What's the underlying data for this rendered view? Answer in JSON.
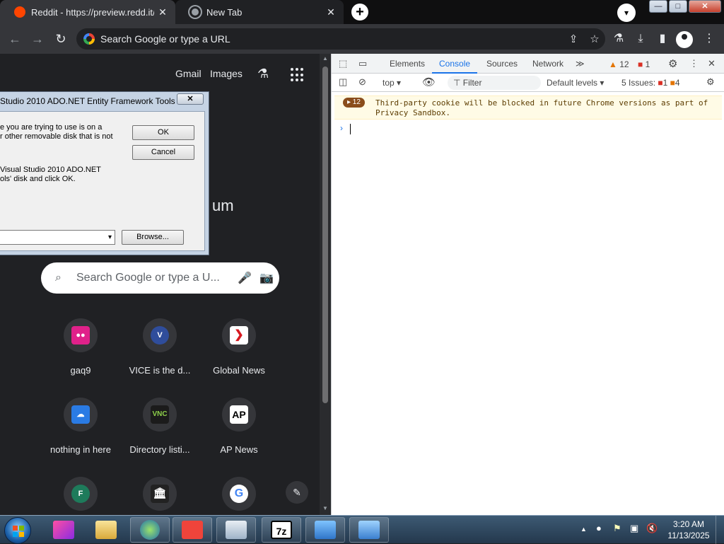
{
  "browser": {
    "tabs": [
      {
        "title": "Reddit - https://preview.redd.it/s",
        "close": "✕"
      },
      {
        "title": "New Tab",
        "close": "✕"
      }
    ],
    "new_tab_symbol": "+",
    "omnibox_placeholder": "Search Google or type a URL",
    "window_buttons": {
      "minimize": "—",
      "maximize": "□",
      "close": "✕"
    }
  },
  "ntp": {
    "header_links": [
      "Gmail",
      "Images"
    ],
    "logo_fragment": "um",
    "search_placeholder": "Search Google or type a U...",
    "shortcuts": [
      {
        "label": "gaq9",
        "glyph": "●●",
        "color": "#e0218a"
      },
      {
        "label": "VICE is the d...",
        "glyph": "V",
        "color": "#2f4d9b"
      },
      {
        "label": "Global News",
        "glyph": "❯",
        "color": "#d71920"
      },
      {
        "label": "nothing in here",
        "glyph": "☁",
        "color": "#2a7be4"
      },
      {
        "label": "Directory listi...",
        "glyph": "VNC",
        "color": "#1b1b1b"
      },
      {
        "label": "AP News",
        "glyph": "AP",
        "color": "#ffffff"
      },
      {
        "label": "",
        "glyph": "F",
        "color": "#1e7b5b"
      },
      {
        "label": "",
        "glyph": "🏛",
        "color": "#222222"
      },
      {
        "label": "",
        "glyph": "G",
        "color": "#4285f4"
      }
    ],
    "edit_icon": "✎"
  },
  "dialog": {
    "title": "Studio 2010 ADO.NET Entity Framework Tools",
    "close": "✕",
    "message_lines": [
      "e you are trying to use is on a",
      "r other removable disk that is not"
    ],
    "message_lines_2": [
      "Visual Studio 2010 ADO.NET",
      "ols' disk and click OK."
    ],
    "ok": "OK",
    "cancel": "Cancel",
    "browse": "Browse...",
    "combo_arrow": "▾"
  },
  "devtools": {
    "tabs": [
      "Elements",
      "Console",
      "Sources",
      "Network"
    ],
    "active_tab": "Console",
    "more": "≫",
    "warnings_count": "12",
    "errors_count": "1",
    "context": "top",
    "filter_placeholder": "Filter",
    "levels": "Default levels",
    "issues_label": "5 Issues:",
    "issues_errors": "1",
    "issues_warnings": "4",
    "message_badge": "▸ 12",
    "message_text": "Third-party cookie will be blocked in future Chrome versions as part of Privacy Sandbox.",
    "prompt": "›"
  },
  "taskbar": {
    "time": "3:20 AM",
    "date": "11/13/2025",
    "tray_arrow": "▲"
  }
}
